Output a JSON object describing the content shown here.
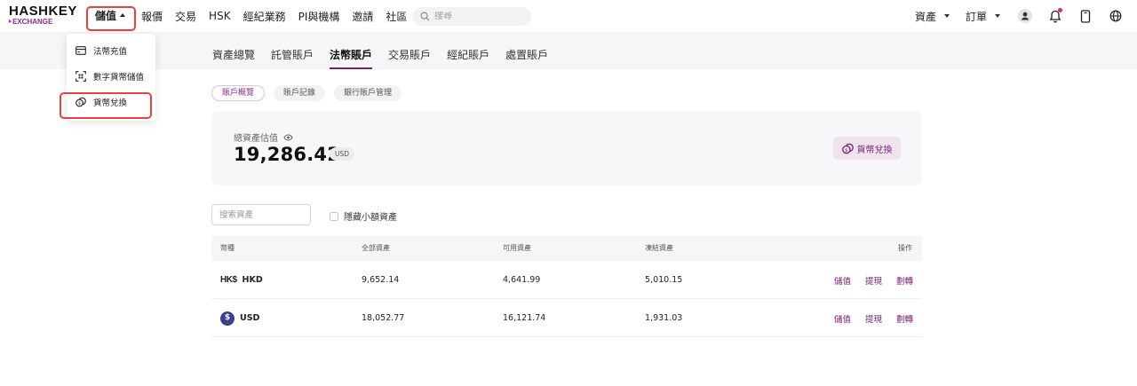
{
  "logo": {
    "main": "HASHKEY",
    "sub": "EXCHANGE"
  },
  "nav": {
    "items": [
      {
        "label": "儲值",
        "name": "nav-deposit",
        "active": true
      },
      {
        "label": "報價",
        "name": "nav-quotes"
      },
      {
        "label": "交易",
        "name": "nav-trade"
      },
      {
        "label": "HSK",
        "name": "nav-hsk"
      },
      {
        "label": "經紀業務",
        "name": "nav-brokerage"
      },
      {
        "label": "PI與機構",
        "name": "nav-pi-institutions"
      },
      {
        "label": "邀請",
        "name": "nav-invite"
      },
      {
        "label": "社區",
        "name": "nav-community"
      }
    ],
    "search_placeholder": "搜尋",
    "assets_label": "資產",
    "orders_label": "訂單"
  },
  "dropdown": {
    "items": [
      {
        "label": "法幣充值",
        "icon": "card-icon"
      },
      {
        "label": "數字貨幣儲值",
        "icon": "qr-scan-icon"
      },
      {
        "label": "貨幣兌換",
        "icon": "coin-exchange-icon"
      }
    ]
  },
  "tabs": [
    "資產總覽",
    "託管賬戶",
    "法幣賬戶",
    "交易賬戶",
    "經紀賬戶",
    "處置賬戶"
  ],
  "active_tab": 2,
  "chips": [
    "賬戶概覽",
    "賬戶記錄",
    "銀行賬戶管理"
  ],
  "balance": {
    "label": "總資產估值",
    "amount": "19,286.42",
    "unit": "USD",
    "exchange_button": "貨幣兌換"
  },
  "filters": {
    "search_placeholder": "搜索資產",
    "hide_small": "隱藏小額資產"
  },
  "table": {
    "headers": {
      "coin": "幣種",
      "total": "全部資產",
      "available": "可用資產",
      "frozen": "凍結資產",
      "ops": "操作"
    },
    "rows": [
      {
        "coin": "HKD",
        "icon_text": "HK$",
        "total": "9,652.14",
        "available": "4,641.99",
        "frozen": "5,010.15"
      },
      {
        "coin": "USD",
        "icon_text": "$",
        "total": "18,052.77",
        "available": "16,121.74",
        "frozen": "1,931.03"
      }
    ],
    "actions": [
      "儲值",
      "提現",
      "劃轉"
    ]
  },
  "colors": {
    "accent": "#7a1f6e",
    "highlight_box": "#e5433f",
    "card_bg": "#f7f7f9"
  }
}
